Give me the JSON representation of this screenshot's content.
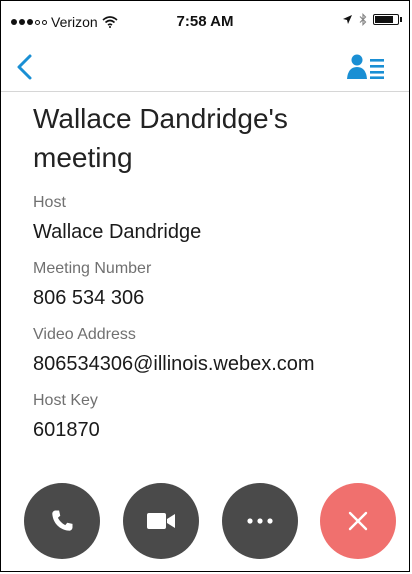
{
  "status_bar": {
    "carrier": "Verizon",
    "time": "7:58 AM",
    "signal_bars_filled": 3,
    "signal_bars_total": 5,
    "battery_level": 0.9
  },
  "nav": {
    "back_icon": "chevron-left-icon",
    "participants_icon": "participants-list-icon",
    "accent_color": "#1a8fd4"
  },
  "meeting": {
    "title": "Wallace Dandridge's meeting",
    "fields": [
      {
        "label": "Host",
        "value": "Wallace Dandridge"
      },
      {
        "label": "Meeting Number",
        "value": "806 534 306"
      },
      {
        "label": "Video Address",
        "value": "806534306@illinois.webex.com"
      },
      {
        "label": "Host Key",
        "value": "601870"
      }
    ]
  },
  "actions": [
    {
      "name": "call",
      "icon": "phone-icon",
      "color": "#4a4a4a"
    },
    {
      "name": "video",
      "icon": "video-camera-icon",
      "color": "#4a4a4a"
    },
    {
      "name": "more",
      "icon": "more-dots-icon",
      "color": "#4a4a4a"
    },
    {
      "name": "end",
      "icon": "close-icon",
      "color": "#f0706e"
    }
  ]
}
